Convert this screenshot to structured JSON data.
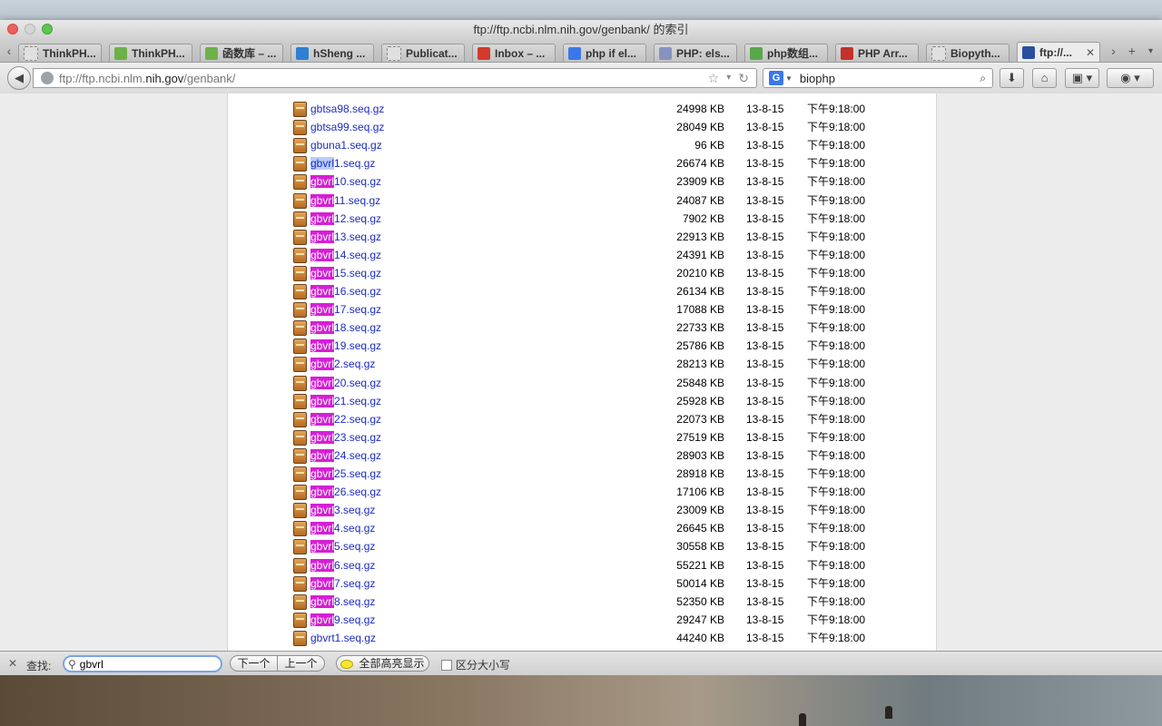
{
  "window": {
    "title": "ftp://ftp.ncbi.nlm.nih.gov/genbank/ 的索引"
  },
  "tabs": [
    {
      "label": "ThinkPH...",
      "icon": "page-icon",
      "color": "#e0e0e0"
    },
    {
      "label": "ThinkPH...",
      "icon": "thinkphp-icon",
      "color": "#6eb04a"
    },
    {
      "label": "函数库 – ...",
      "icon": "thinkphp-icon",
      "color": "#6eb04a"
    },
    {
      "label": "hSheng ...",
      "icon": "blog-icon",
      "color": "#2f7fd3"
    },
    {
      "label": "Publicat...",
      "icon": "page-icon",
      "color": "#e0e0e0"
    },
    {
      "label": "Inbox – ...",
      "icon": "gmail-icon",
      "color": "#d4392d"
    },
    {
      "label": "php if el...",
      "icon": "google-icon",
      "color": "#3b78e7"
    },
    {
      "label": "PHP: els...",
      "icon": "php-icon",
      "color": "#8892bf"
    },
    {
      "label": "php数组...",
      "icon": "site-icon",
      "color": "#5aa74a"
    },
    {
      "label": "PHP Arr...",
      "icon": "w3-icon",
      "color": "#c2312a"
    },
    {
      "label": "Biopyth...",
      "icon": "page-icon",
      "color": "#e0e0e0"
    },
    {
      "label": "ftp://...",
      "icon": "monitor-icon",
      "color": "#2a4fa0",
      "active": true
    }
  ],
  "navbar": {
    "url_prefix": "ftp://ftp.ncbi.nlm.",
    "url_domain": "nih.gov",
    "url_suffix": "/genbank/",
    "search_value": "biophp",
    "search_engine": "G"
  },
  "files": [
    {
      "pre": "gbtsa98.seq.gz",
      "match": "",
      "post": "",
      "size": "24998 KB",
      "date": "13-8-15",
      "time": "下午9:18:00"
    },
    {
      "pre": "gbtsa99.seq.gz",
      "match": "",
      "post": "",
      "size": "28049 KB",
      "date": "13-8-15",
      "time": "下午9:18:00"
    },
    {
      "pre": "gbuna1.seq.gz",
      "match": "",
      "post": "",
      "size": "96 KB",
      "date": "13-8-15",
      "time": "下午9:18:00"
    },
    {
      "pre": "",
      "match": "gbvrl",
      "post": "1.seq.gz",
      "size": "26674 KB",
      "date": "13-8-15",
      "time": "下午9:18:00",
      "selected": true
    },
    {
      "pre": "",
      "match": "gbvrl",
      "post": "10.seq.gz",
      "size": "23909 KB",
      "date": "13-8-15",
      "time": "下午9:18:00"
    },
    {
      "pre": "",
      "match": "gbvrl",
      "post": "11.seq.gz",
      "size": "24087 KB",
      "date": "13-8-15",
      "time": "下午9:18:00"
    },
    {
      "pre": "",
      "match": "gbvrl",
      "post": "12.seq.gz",
      "size": "7902 KB",
      "date": "13-8-15",
      "time": "下午9:18:00"
    },
    {
      "pre": "",
      "match": "gbvrl",
      "post": "13.seq.gz",
      "size": "22913 KB",
      "date": "13-8-15",
      "time": "下午9:18:00"
    },
    {
      "pre": "",
      "match": "gbvrl",
      "post": "14.seq.gz",
      "size": "24391 KB",
      "date": "13-8-15",
      "time": "下午9:18:00"
    },
    {
      "pre": "",
      "match": "gbvrl",
      "post": "15.seq.gz",
      "size": "20210 KB",
      "date": "13-8-15",
      "time": "下午9:18:00"
    },
    {
      "pre": "",
      "match": "gbvrl",
      "post": "16.seq.gz",
      "size": "26134 KB",
      "date": "13-8-15",
      "time": "下午9:18:00"
    },
    {
      "pre": "",
      "match": "gbvrl",
      "post": "17.seq.gz",
      "size": "17088 KB",
      "date": "13-8-15",
      "time": "下午9:18:00"
    },
    {
      "pre": "",
      "match": "gbvrl",
      "post": "18.seq.gz",
      "size": "22733 KB",
      "date": "13-8-15",
      "time": "下午9:18:00"
    },
    {
      "pre": "",
      "match": "gbvrl",
      "post": "19.seq.gz",
      "size": "25786 KB",
      "date": "13-8-15",
      "time": "下午9:18:00"
    },
    {
      "pre": "",
      "match": "gbvrl",
      "post": "2.seq.gz",
      "size": "28213 KB",
      "date": "13-8-15",
      "time": "下午9:18:00"
    },
    {
      "pre": "",
      "match": "gbvrl",
      "post": "20.seq.gz",
      "size": "25848 KB",
      "date": "13-8-15",
      "time": "下午9:18:00"
    },
    {
      "pre": "",
      "match": "gbvrl",
      "post": "21.seq.gz",
      "size": "25928 KB",
      "date": "13-8-15",
      "time": "下午9:18:00"
    },
    {
      "pre": "",
      "match": "gbvrl",
      "post": "22.seq.gz",
      "size": "22073 KB",
      "date": "13-8-15",
      "time": "下午9:18:00"
    },
    {
      "pre": "",
      "match": "gbvrl",
      "post": "23.seq.gz",
      "size": "27519 KB",
      "date": "13-8-15",
      "time": "下午9:18:00"
    },
    {
      "pre": "",
      "match": "gbvrl",
      "post": "24.seq.gz",
      "size": "28903 KB",
      "date": "13-8-15",
      "time": "下午9:18:00"
    },
    {
      "pre": "",
      "match": "gbvrl",
      "post": "25.seq.gz",
      "size": "28918 KB",
      "date": "13-8-15",
      "time": "下午9:18:00"
    },
    {
      "pre": "",
      "match": "gbvrl",
      "post": "26.seq.gz",
      "size": "17106 KB",
      "date": "13-8-15",
      "time": "下午9:18:00"
    },
    {
      "pre": "",
      "match": "gbvrl",
      "post": "3.seq.gz",
      "size": "23009 KB",
      "date": "13-8-15",
      "time": "下午9:18:00"
    },
    {
      "pre": "",
      "match": "gbvrl",
      "post": "4.seq.gz",
      "size": "26645 KB",
      "date": "13-8-15",
      "time": "下午9:18:00"
    },
    {
      "pre": "",
      "match": "gbvrl",
      "post": "5.seq.gz",
      "size": "30558 KB",
      "date": "13-8-15",
      "time": "下午9:18:00"
    },
    {
      "pre": "",
      "match": "gbvrl",
      "post": "6.seq.gz",
      "size": "55221 KB",
      "date": "13-8-15",
      "time": "下午9:18:00"
    },
    {
      "pre": "",
      "match": "gbvrl",
      "post": "7.seq.gz",
      "size": "50014 KB",
      "date": "13-8-15",
      "time": "下午9:18:00"
    },
    {
      "pre": "",
      "match": "gbvrl",
      "post": "8.seq.gz",
      "size": "52350 KB",
      "date": "13-8-15",
      "time": "下午9:18:00"
    },
    {
      "pre": "",
      "match": "gbvrl",
      "post": "9.seq.gz",
      "size": "29247 KB",
      "date": "13-8-15",
      "time": "下午9:18:00"
    },
    {
      "pre": "gbvrt1.seq.gz",
      "match": "",
      "post": "",
      "size": "44240 KB",
      "date": "13-8-15",
      "time": "下午9:18:00"
    }
  ],
  "findbar": {
    "label": "查找:",
    "query": "gbvrl",
    "next_label": "下一个",
    "prev_label": "上一个",
    "highlight_all_label": "全部高亮显示",
    "match_case_label": "区分大小写",
    "match_case_checked": false
  }
}
